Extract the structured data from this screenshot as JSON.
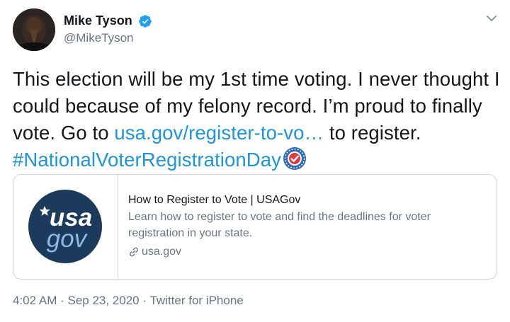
{
  "author": {
    "display_name": "Mike Tyson",
    "handle": "@MikeTyson",
    "verified_icon": "verified-badge-icon",
    "avatar_icon": "avatar-photo"
  },
  "tweet": {
    "text_part1": "This election will be my 1st time voting. I never thought I could because of my felony record. I’m proud to finally vote. Go to ",
    "link_text": "usa.gov/register-to-vo…",
    "text_part2": " to register.",
    "hashtag": "#NationalVoterRegistrationDay",
    "hashtag_emoji": "ballot-check-badge-icon"
  },
  "card": {
    "logo_line1": "usa",
    "logo_line2": "gov",
    "title": "How to Register to Vote | USAGov",
    "description": "Learn how to register to vote and find the deadlines for voter registration in your state.",
    "domain": "usa.gov"
  },
  "meta": {
    "time": "4:02 AM",
    "separator1": " · ",
    "date": "Sep 23, 2020",
    "separator2": " · ",
    "source": "Twitter for iPhone"
  },
  "colors": {
    "link": "#1b95e0",
    "verified": "#1da1f2",
    "usagov_navy": "#1b3a5c",
    "usagov_light": "#91b9e5"
  }
}
